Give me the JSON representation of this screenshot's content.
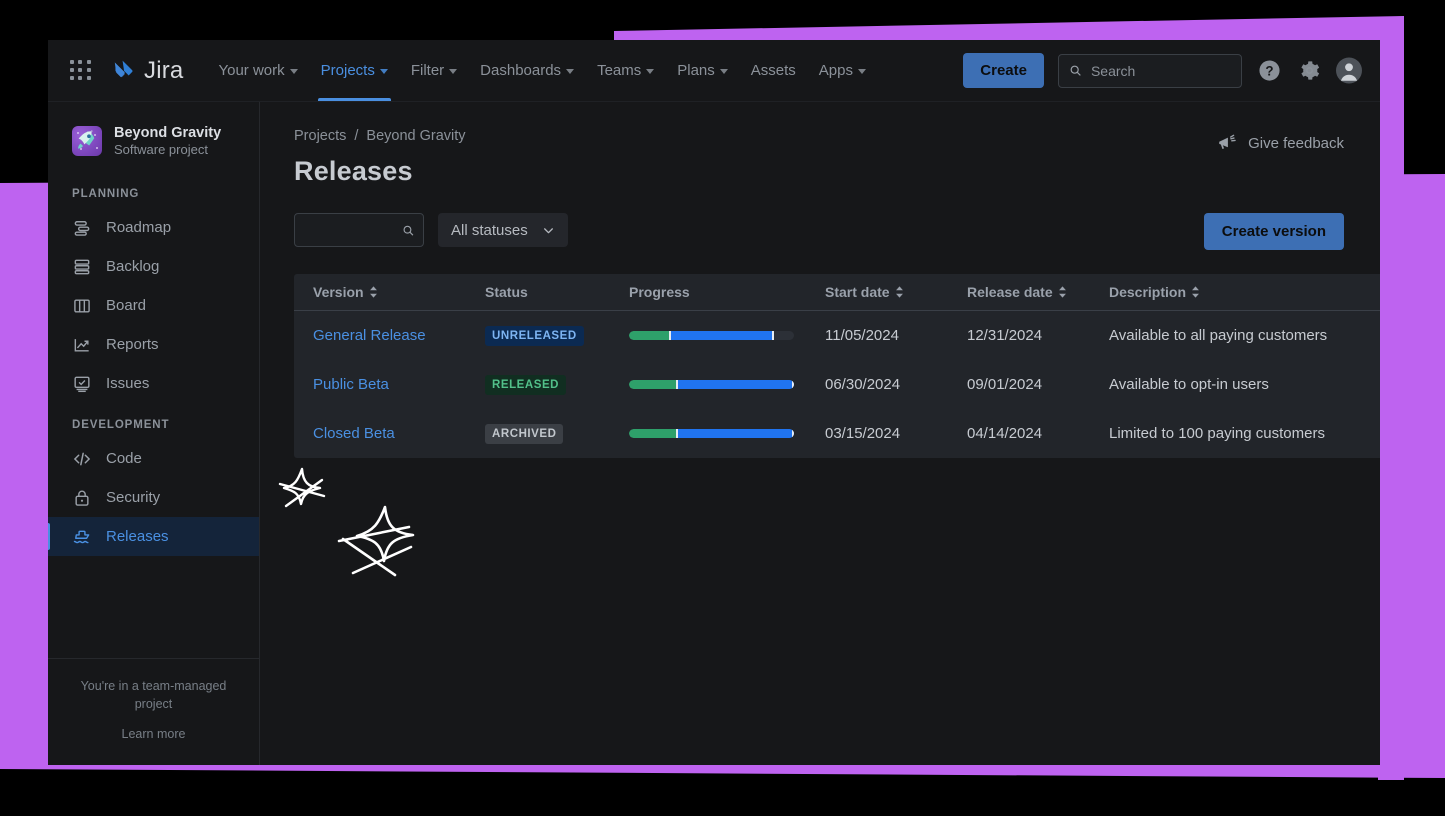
{
  "topnav": {
    "brand": "Jira",
    "app_switcher_icon": "grid-apps-icon",
    "items": [
      {
        "label": "Your work",
        "has_caret": true,
        "active": false
      },
      {
        "label": "Projects",
        "has_caret": true,
        "active": true
      },
      {
        "label": "Filter",
        "has_caret": true,
        "active": false
      },
      {
        "label": "Dashboards",
        "has_caret": true,
        "active": false
      },
      {
        "label": "Teams",
        "has_caret": true,
        "active": false
      },
      {
        "label": "Plans",
        "has_caret": true,
        "active": false
      },
      {
        "label": "Assets",
        "has_caret": false,
        "active": false
      },
      {
        "label": "Apps",
        "has_caret": true,
        "active": false
      }
    ],
    "create_label": "Create",
    "search_placeholder": "Search",
    "search_value": "",
    "help_icon": "question-circle-icon",
    "settings_icon": "gear-icon",
    "avatar_icon": "user-avatar-icon"
  },
  "sidebar": {
    "project_name": "Beyond Gravity",
    "project_type": "Software project",
    "project_avatar_icon": "rocket-icon",
    "sections": [
      {
        "label": "PLANNING",
        "items": [
          {
            "label": "Roadmap",
            "icon": "roadmap-icon",
            "active": false
          },
          {
            "label": "Backlog",
            "icon": "backlog-icon",
            "active": false
          },
          {
            "label": "Board",
            "icon": "board-icon",
            "active": false
          },
          {
            "label": "Reports",
            "icon": "reports-icon",
            "active": false
          },
          {
            "label": "Issues",
            "icon": "issues-icon",
            "active": false
          }
        ]
      },
      {
        "label": "DEVELOPMENT",
        "items": [
          {
            "label": "Code",
            "icon": "code-icon",
            "active": false
          },
          {
            "label": "Security",
            "icon": "lock-icon",
            "active": false
          },
          {
            "label": "Releases",
            "icon": "ship-icon",
            "active": true
          }
        ]
      }
    ],
    "footer_note": "You're in a team-managed project",
    "footer_link": "Learn more"
  },
  "main": {
    "breadcrumb": {
      "root": "Projects",
      "separator": "/",
      "current": "Beyond Gravity"
    },
    "page_title": "Releases",
    "feedback_label": "Give feedback",
    "feedback_icon": "megaphone-icon",
    "toolbar": {
      "search_value": "",
      "search_placeholder": "",
      "search_icon": "search-icon",
      "status_filter_label": "All statuses",
      "status_filter_caret": "chevron-down-icon",
      "create_version_label": "Create version"
    },
    "table": {
      "columns": [
        {
          "label": "Version",
          "sortable": true
        },
        {
          "label": "Status",
          "sortable": false
        },
        {
          "label": "Progress",
          "sortable": false
        },
        {
          "label": "Start date",
          "sortable": true
        },
        {
          "label": "Release date",
          "sortable": true
        },
        {
          "label": "Description",
          "sortable": true
        }
      ],
      "rows": [
        {
          "version": "General Release",
          "status": "UNRELEASED",
          "status_variant": "unreleased",
          "progress": {
            "green_pct": 25,
            "blue_pct": 63,
            "total_pct": 88
          },
          "start_date": "11/05/2024",
          "release_date": "12/31/2024",
          "description": "Available to all paying customers",
          "more_label": "•••"
        },
        {
          "version": "Public Beta",
          "status": "RELEASED",
          "status_variant": "released",
          "progress": {
            "green_pct": 29,
            "blue_pct": 71,
            "total_pct": 100
          },
          "start_date": "06/30/2024",
          "release_date": "09/01/2024",
          "description": "Available to opt-in users",
          "more_label": "•••"
        },
        {
          "version": "Closed Beta",
          "status": "ARCHIVED",
          "status_variant": "archived",
          "progress": {
            "green_pct": 29,
            "blue_pct": 71,
            "total_pct": 100
          },
          "start_date": "03/15/2024",
          "release_date": "04/14/2024",
          "description": "Limited to 100 paying customers",
          "more_label": "•••"
        }
      ]
    }
  },
  "decorations": {
    "doodles": [
      "star-doodle",
      "star-doodle"
    ],
    "accent_purple": "#be63f0",
    "accent_blue": "#4a90e2",
    "progress_green": "#2ea06a",
    "progress_blue": "#2074f0"
  }
}
